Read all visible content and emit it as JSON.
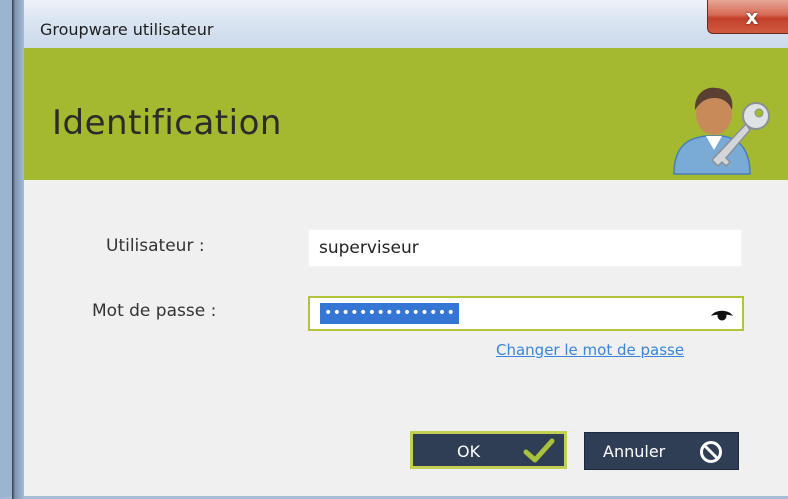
{
  "window": {
    "title": "Groupware utilisateur",
    "close_label": "x"
  },
  "header": {
    "title": "Identification",
    "icon": "user-key-icon"
  },
  "form": {
    "user_label": "Utilisateur :",
    "user_value": "superviseur",
    "password_label": "Mot de passe :",
    "password_masked": "•••••••••••••••",
    "password_icon": "eye-icon",
    "change_password_link": "Changer le mot de passe"
  },
  "buttons": {
    "ok_label": "OK",
    "ok_icon": "check-icon",
    "cancel_label": "Annuler",
    "cancel_icon": "cancel-icon"
  },
  "colors": {
    "accent_green": "#a4b92f",
    "button_dark": "#2f3e55",
    "link_blue": "#3a85d8",
    "selection_blue": "#3575d3",
    "close_red": "#c2402b"
  }
}
